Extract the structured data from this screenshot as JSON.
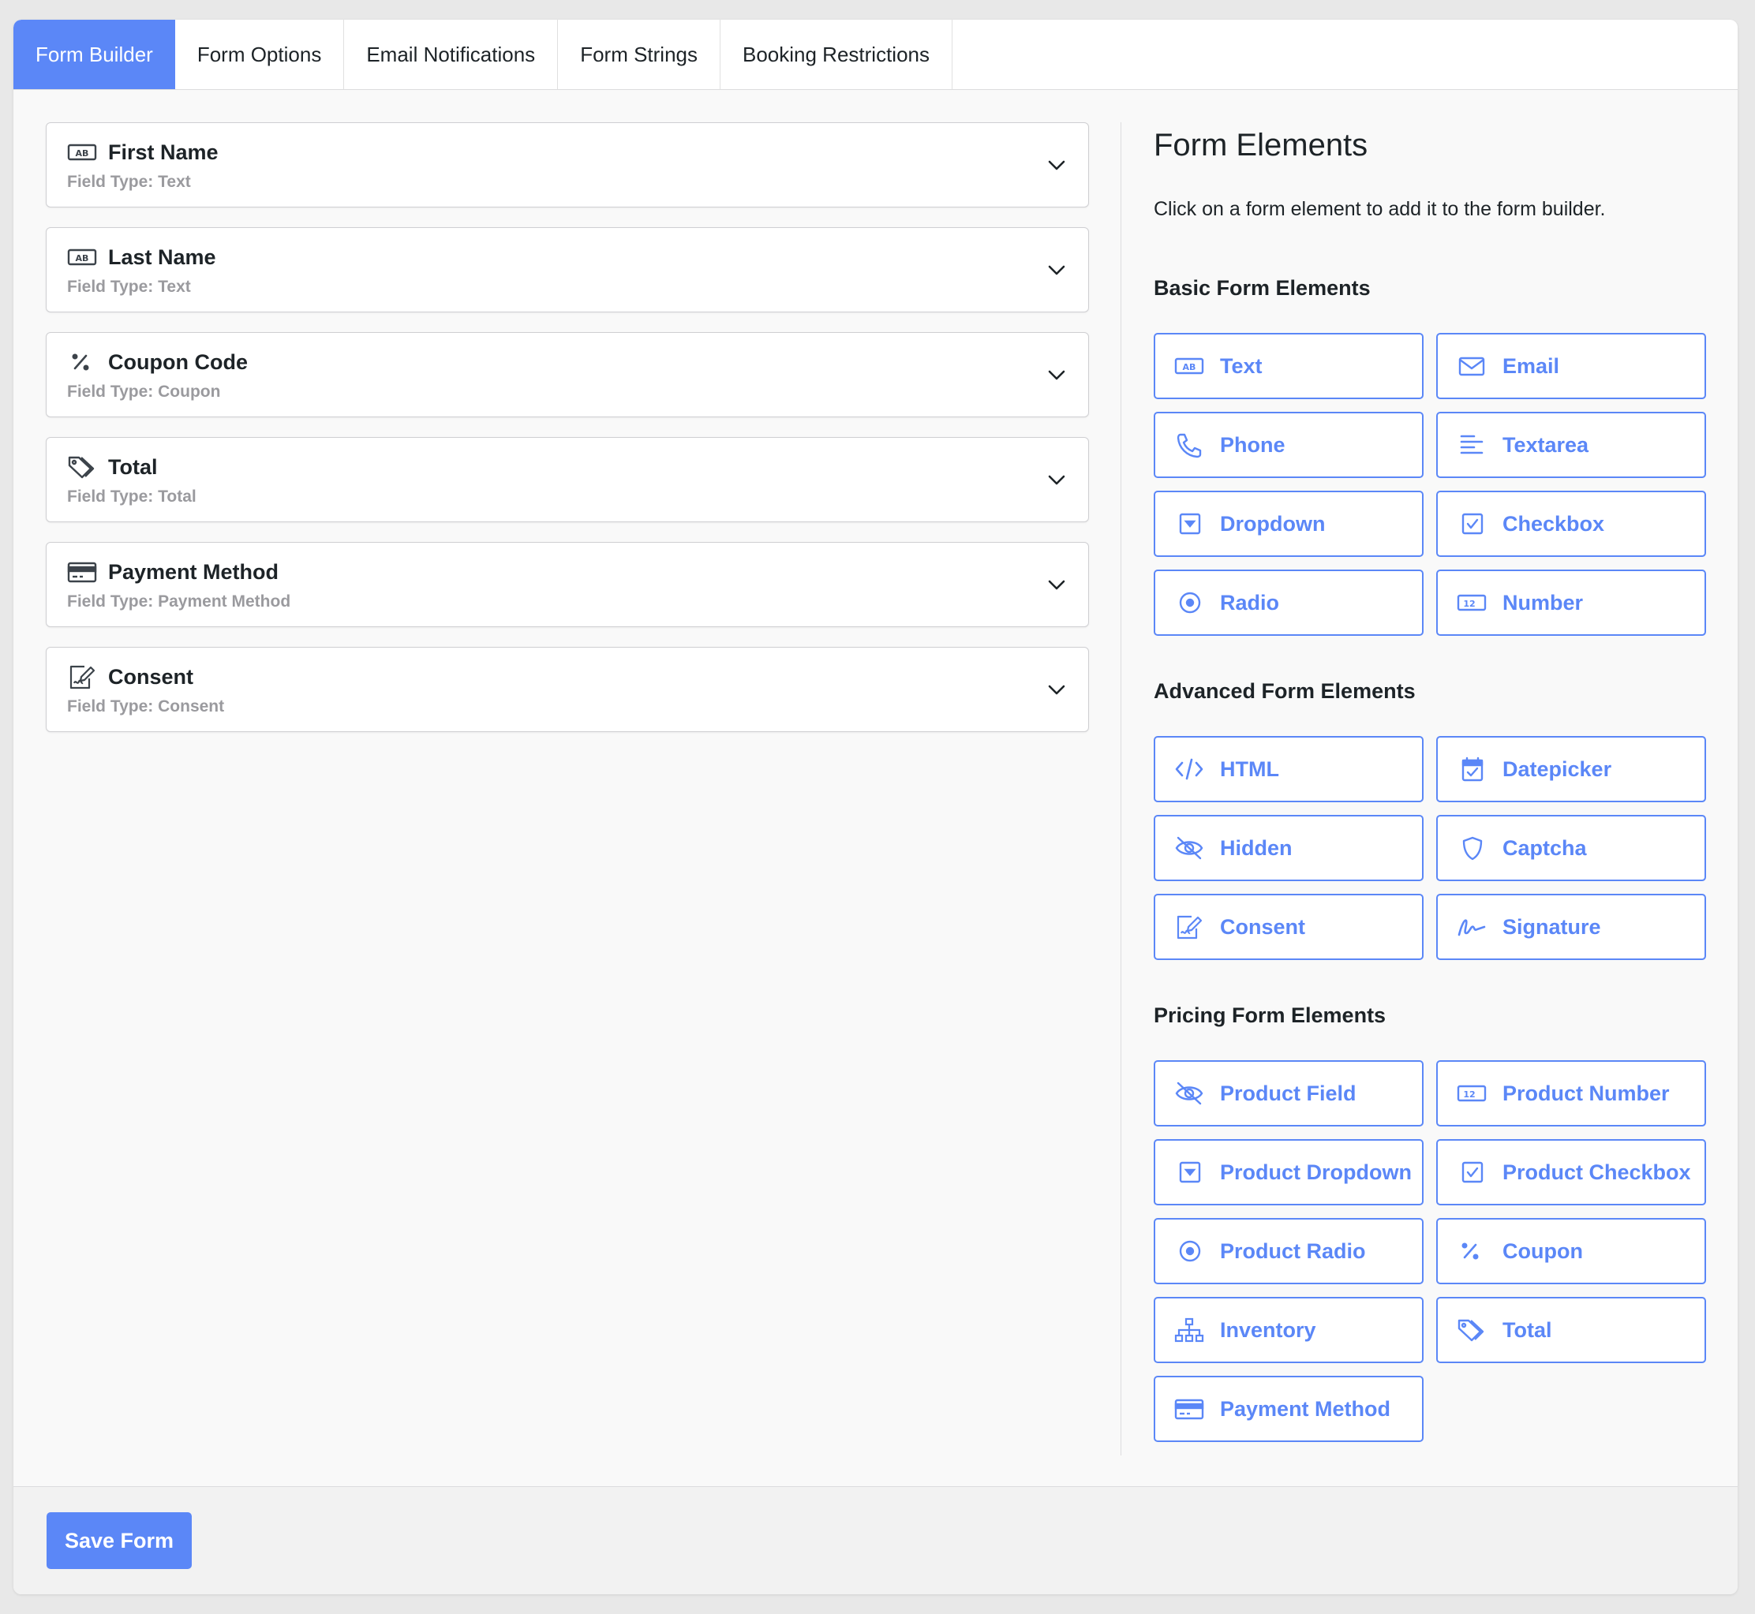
{
  "tabs": [
    {
      "label": "Form Builder",
      "active": true
    },
    {
      "label": "Form Options"
    },
    {
      "label": "Email Notifications"
    },
    {
      "label": "Form Strings"
    },
    {
      "label": "Booking Restrictions"
    }
  ],
  "fields": [
    {
      "title": "First Name",
      "type": "Field Type: Text",
      "icon": "text-field-icon"
    },
    {
      "title": "Last Name",
      "type": "Field Type: Text",
      "icon": "text-field-icon"
    },
    {
      "title": "Coupon Code",
      "type": "Field Type: Coupon",
      "icon": "percent-icon"
    },
    {
      "title": "Total",
      "type": "Field Type: Total",
      "icon": "tag-icon"
    },
    {
      "title": "Payment Method",
      "type": "Field Type: Payment Method",
      "icon": "credit-card-icon"
    },
    {
      "title": "Consent",
      "type": "Field Type: Consent",
      "icon": "consent-icon"
    }
  ],
  "side": {
    "title": "Form Elements",
    "description": "Click on a form element to add it to the form builder.",
    "groups": [
      {
        "title": "Basic Form Elements",
        "items": [
          {
            "label": "Text",
            "icon": "text-field-icon"
          },
          {
            "label": "Email",
            "icon": "envelope-icon"
          },
          {
            "label": "Phone",
            "icon": "phone-icon"
          },
          {
            "label": "Textarea",
            "icon": "textarea-icon"
          },
          {
            "label": "Dropdown",
            "icon": "dropdown-icon"
          },
          {
            "label": "Checkbox",
            "icon": "checkbox-icon"
          },
          {
            "label": "Radio",
            "icon": "radio-icon"
          },
          {
            "label": "Number",
            "icon": "number-icon"
          }
        ]
      },
      {
        "title": "Advanced Form Elements",
        "items": [
          {
            "label": "HTML",
            "icon": "code-icon"
          },
          {
            "label": "Datepicker",
            "icon": "calendar-icon"
          },
          {
            "label": "Hidden",
            "icon": "eye-slash-icon"
          },
          {
            "label": "Captcha",
            "icon": "shield-icon"
          },
          {
            "label": "Consent",
            "icon": "consent-icon"
          },
          {
            "label": "Signature",
            "icon": "signature-icon"
          }
        ]
      },
      {
        "title": "Pricing Form Elements",
        "items": [
          {
            "label": "Product Field",
            "icon": "eye-slash-icon"
          },
          {
            "label": "Product Number",
            "icon": "number-icon"
          },
          {
            "label": "Product Dropdown",
            "icon": "dropdown-icon"
          },
          {
            "label": "Product Checkbox",
            "icon": "checkbox-icon"
          },
          {
            "label": "Product Radio",
            "icon": "radio-icon"
          },
          {
            "label": "Coupon",
            "icon": "percent-icon"
          },
          {
            "label": "Inventory",
            "icon": "sitemap-icon"
          },
          {
            "label": "Total",
            "icon": "tag-icon"
          },
          {
            "label": "Payment Method",
            "icon": "credit-card-icon"
          }
        ]
      }
    ]
  },
  "footer": {
    "save_label": "Save Form"
  },
  "colors": {
    "accent": "#5b87f7",
    "muted": "#9a9a9e",
    "text": "#1d2327"
  }
}
